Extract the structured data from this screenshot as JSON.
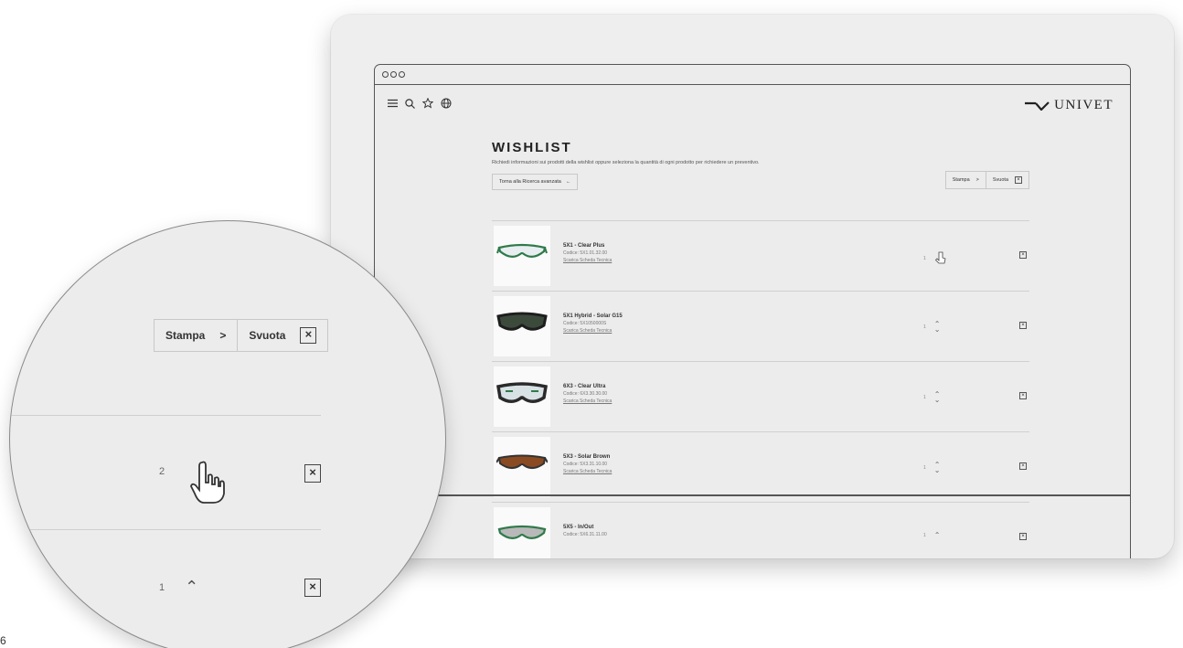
{
  "header": {
    "brand": "UNIVET"
  },
  "wishlist": {
    "title": "WISHLIST",
    "description": "Richiedi informazioni sui prodotti della wishlist oppure seleziona la quantità di ogni prodotto per richiedere un preventivo.",
    "back_label": "Torna alla Ricerca avanzata",
    "print_label": "Stampa",
    "empty_label": "Svuota"
  },
  "products": [
    {
      "name": "5X1 - Clear Plus",
      "code": "Codice: 5X1.01.32.00",
      "link": "Scarica Scheda Tecnica",
      "qty": "1",
      "frame_color": "#2f7a4a",
      "lens_color": "#e8eef0"
    },
    {
      "name": "5X1 Hybrid - Solar G15",
      "code": "Codice: 5X1050000S",
      "link": "Scarica Scheda Tecnica",
      "qty": "1",
      "frame_color": "#1e1e1e",
      "lens_color": "#3c4a3c"
    },
    {
      "name": "6X3 - Clear Ultra",
      "code": "Codice: 6X3.30.30.00",
      "link": "Scarica Scheda Tecnica",
      "qty": "1",
      "frame_color": "#2a2a2a",
      "lens_color": "#d8e2e4"
    },
    {
      "name": "5X3 - Solar Brown",
      "code": "Codice: 5X3.31.10.00",
      "link": "Scarica Scheda Tecnica",
      "qty": "1",
      "frame_color": "#333333",
      "lens_color": "#8a4a22"
    },
    {
      "name": "5X5 - In/Out",
      "code": "Codice: 5X6.31.11.00",
      "link": "",
      "qty": "1",
      "frame_color": "#2f7a4a",
      "lens_color": "#b9b9b9"
    }
  ],
  "magnifier": {
    "print_label": "Stampa",
    "empty_label": "Svuota",
    "qty_1": "2",
    "qty_2": "1"
  },
  "corner_text": "6"
}
